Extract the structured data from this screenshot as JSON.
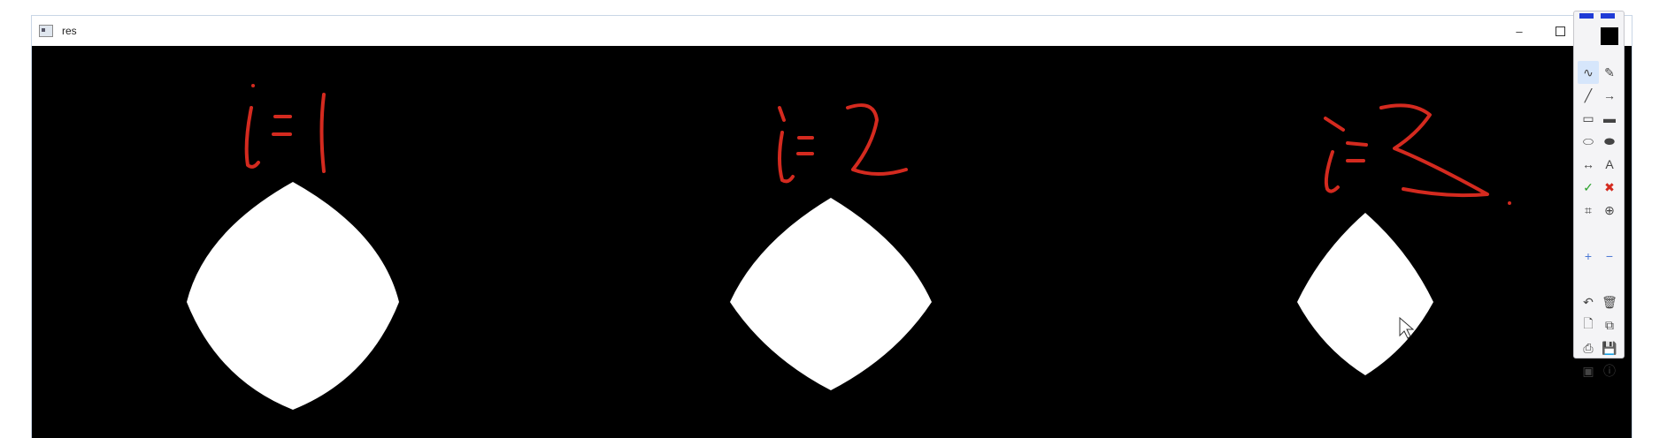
{
  "window": {
    "title": "res",
    "minimize_glyph": "–"
  },
  "annotations": {
    "color": "#d42a1f",
    "labels": [
      "i = 1",
      "i = 2",
      "i = 3"
    ]
  },
  "toolbar": {
    "colors": {
      "swatch_blue": "#1f3bd6",
      "swatch_black": "#000000"
    },
    "tools": [
      {
        "name": "freehand-tool-button",
        "glyph": "∿",
        "active": true
      },
      {
        "name": "pen-tool-button",
        "glyph": "✎",
        "active": false
      },
      {
        "name": "line-tool-button",
        "glyph": "╱",
        "active": false
      },
      {
        "name": "arrow-tool-button",
        "glyph": "→",
        "active": false
      },
      {
        "name": "rectangle-tool-button",
        "glyph": "▭",
        "active": false
      },
      {
        "name": "filled-rectangle-tool-button",
        "glyph": "▬",
        "active": false
      },
      {
        "name": "ellipse-tool-button",
        "glyph": "⬭",
        "active": false
      },
      {
        "name": "filled-ellipse-tool-button",
        "glyph": "⬬",
        "active": false
      },
      {
        "name": "double-arrow-tool-button",
        "glyph": "↔",
        "active": false
      },
      {
        "name": "text-tool-button",
        "glyph": "A",
        "active": false
      },
      {
        "name": "check-tool-button",
        "glyph": "✓",
        "active": false
      },
      {
        "name": "cross-tool-button",
        "glyph": "✖",
        "active": false
      },
      {
        "name": "crop-tool-button",
        "glyph": "⌗",
        "active": false
      },
      {
        "name": "zoom-tool-button",
        "glyph": "⊕",
        "active": false
      },
      {
        "name": "plus-button",
        "glyph": "+",
        "active": false
      },
      {
        "name": "minus-button",
        "glyph": "−",
        "active": false
      },
      {
        "name": "undo-button",
        "glyph": "↶",
        "active": false
      },
      {
        "name": "delete-button",
        "glyph": "🗑",
        "active": false
      },
      {
        "name": "new-page-button",
        "glyph": "🗋",
        "active": false
      },
      {
        "name": "copy-button",
        "glyph": "⧉",
        "active": false
      },
      {
        "name": "print-button",
        "glyph": "⎙",
        "active": false
      },
      {
        "name": "save-button",
        "glyph": "💾",
        "active": false
      },
      {
        "name": "screenshot-button",
        "glyph": "▣",
        "active": false
      },
      {
        "name": "info-button",
        "glyph": "ⓘ",
        "active": false
      }
    ]
  }
}
